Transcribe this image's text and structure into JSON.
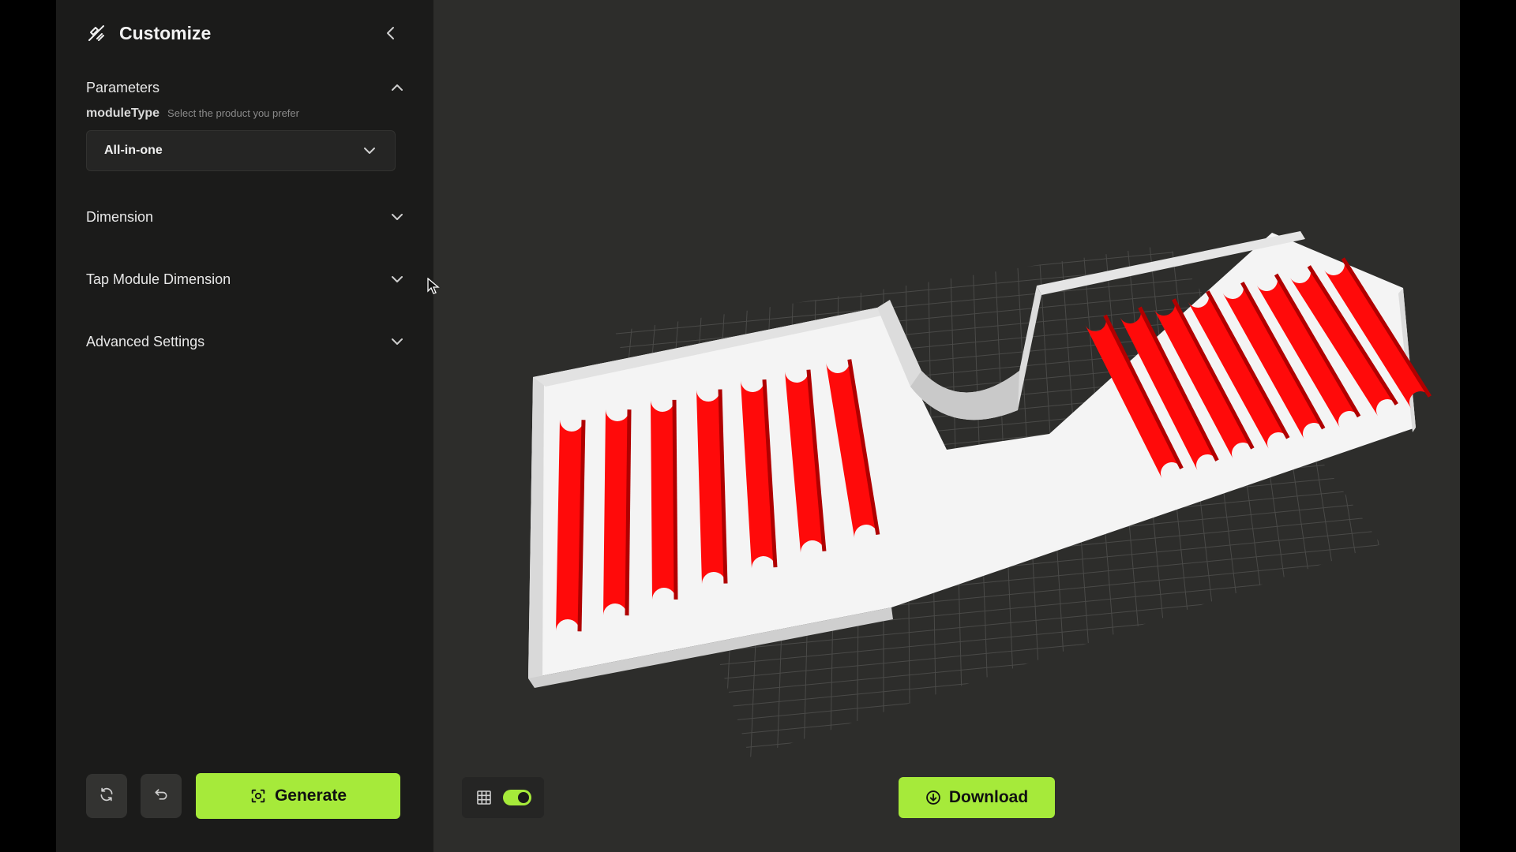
{
  "sidebar": {
    "title": "Customize",
    "title_icon": "customize-tools-icon",
    "collapse_icon": "chevron-left-icon",
    "sections": [
      {
        "label": "Parameters",
        "expanded": true
      },
      {
        "label": "Dimension",
        "expanded": false
      },
      {
        "label": "Tap Module Dimension",
        "expanded": false
      },
      {
        "label": "Advanced Settings",
        "expanded": false
      }
    ],
    "parameter": {
      "name": "moduleType",
      "hint": "Select the product you prefer",
      "selected_value": "All-in-one"
    },
    "footer": {
      "reset_icon": "refresh-icon",
      "undo_icon": "undo-icon",
      "generate_label": "Generate"
    }
  },
  "viewport": {
    "grid_icon": "grid-icon",
    "grid_visible": true,
    "download_label": "Download"
  },
  "colors": {
    "accent": "#a6ea3a",
    "sidebar_bg": "#1b1b1a",
    "viewport_bg": "#2d2d2b",
    "model_base": "#f2f2f2",
    "model_ridges": "#ff0000"
  }
}
